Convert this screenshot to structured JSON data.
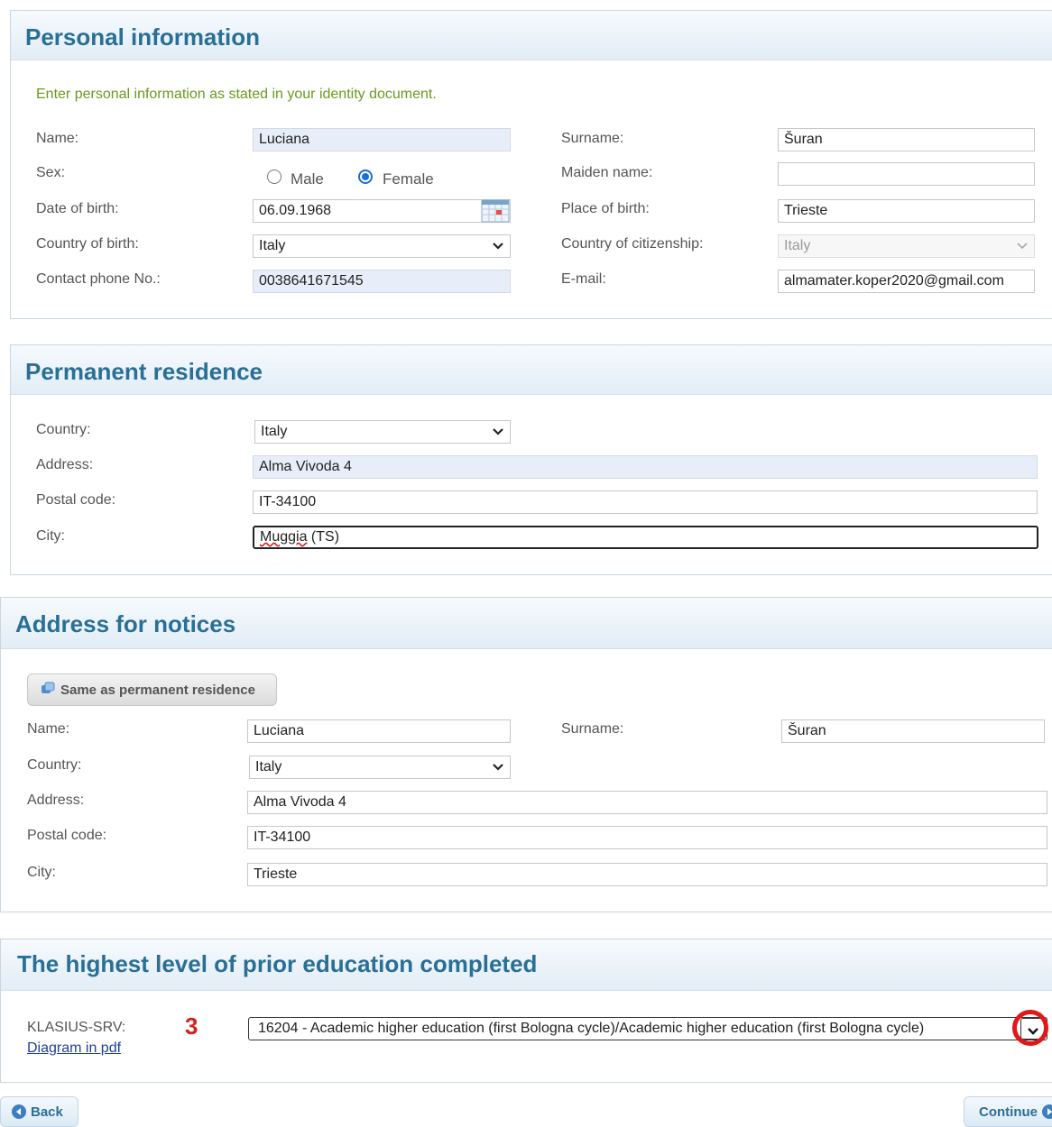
{
  "personal": {
    "title": "Personal information",
    "hint": "Enter personal information as stated in your identity document.",
    "name_label": "Name:",
    "name_value": "Luciana",
    "surname_label": "Surname:",
    "surname_value": "Šuran",
    "sex_label": "Sex:",
    "sex_male": "Male",
    "sex_female": "Female",
    "sex_selected": "Female",
    "maiden_label": "Maiden name:",
    "maiden_value": "",
    "dob_label": "Date of birth:",
    "dob_value": "06.09.1968",
    "pob_label": "Place of birth:",
    "pob_value": "Trieste",
    "cob_label": "Country of birth:",
    "cob_value": "Italy",
    "citizenship_label": "Country of citizenship:",
    "citizenship_value": "Italy",
    "phone_label": "Contact phone No.:",
    "phone_value": "0038641671545",
    "email_label": "E-mail:",
    "email_value": "almamater.koper2020@gmail.com"
  },
  "residence": {
    "title": "Permanent residence",
    "country_label": "Country:",
    "country_value": "Italy",
    "address_label": "Address:",
    "address_value": "Alma Vivoda 4",
    "postal_label": "Postal code:",
    "postal_value": "IT-34100",
    "city_label": "City:",
    "city_word": "Muggia",
    "city_rest": " (TS)"
  },
  "notices": {
    "title": "Address for notices",
    "same_button": "Same as permanent residence",
    "name_label": "Name:",
    "name_value": "Luciana",
    "surname_label": "Surname:",
    "surname_value": "Šuran",
    "country_label": "Country:",
    "country_value": "Italy",
    "address_label": "Address:",
    "address_value": "Alma Vivoda 4",
    "postal_label": "Postal code:",
    "postal_value": "IT-34100",
    "city_label": "City:",
    "city_value": "Trieste"
  },
  "education": {
    "title": "The highest level of prior education completed",
    "klasius_label": "KLASIUS-SRV:",
    "diagram_link": "Diagram in pdf",
    "marker": "3",
    "select_value": "16204 - Academic higher education (first Bologna cycle)/Academic higher education (first Bologna cycle)"
  },
  "footer": {
    "back": "Back",
    "continue": "Continue"
  },
  "colors": {
    "heading": "#2a6f96",
    "hint": "#6a9a1f",
    "annotation": "#e01818"
  },
  "icons": [
    "calendar-icon",
    "chevron-down-icon",
    "copy-icon",
    "back-arrow-icon",
    "forward-arrow-icon"
  ]
}
